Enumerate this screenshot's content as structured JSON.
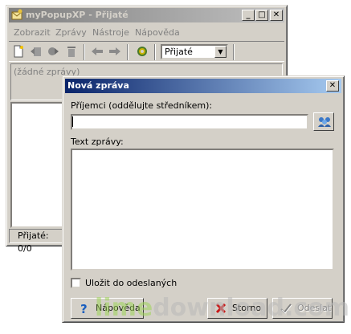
{
  "main_window": {
    "title": "myPopupXP - Přijaté",
    "menu": [
      "Zobrazit",
      "Zprávy",
      "Nástroje",
      "Nápověda"
    ],
    "toolbar_icons": [
      "new-message-icon",
      "reply-icon",
      "forward-icon",
      "delete-icon",
      "previous-icon",
      "next-icon",
      "settings-icon"
    ],
    "folder_select": "Přijaté",
    "message_header": "(žádné zprávy)",
    "status": "Přijaté: 0/0"
  },
  "dialog": {
    "title": "Nová zpráva",
    "recipients_label": "Příjemci (oddělujte středníkem):",
    "recipients_value": "",
    "text_label": "Text zprávy:",
    "text_value": "",
    "save_sent_label": "Uložit do odeslaných",
    "save_sent_checked": false,
    "help_button": "Nápověda",
    "cancel_button": "Storno",
    "send_button": "Odeslat"
  },
  "watermark": {
    "part1": "lime",
    "part2": "download.com"
  },
  "colors": {
    "active_title_start": "#0a246a",
    "active_title_end": "#a6caf0",
    "inactive_title_start": "#808080",
    "inactive_title_end": "#c0c0c0",
    "face": "#d4d0c8"
  }
}
